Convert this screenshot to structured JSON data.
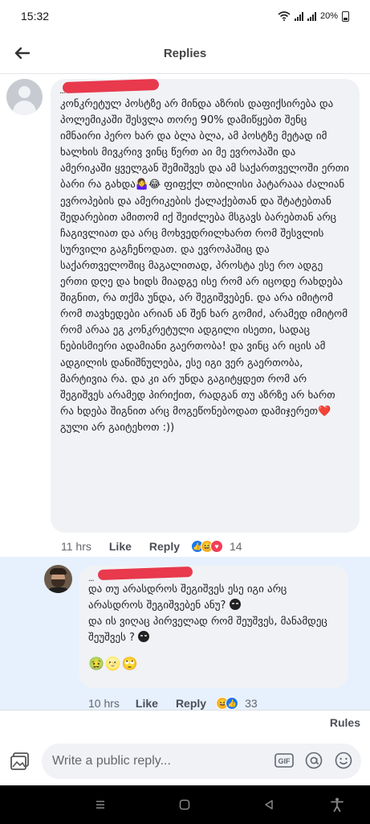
{
  "status_bar": {
    "time": "15:32",
    "battery": "20%"
  },
  "header": {
    "title": "Replies"
  },
  "comment": {
    "author_dots": "...",
    "text": "კონკრეტულ პოსტზე არ მინდა აზრის დაფიქსირება და პოლემიკაში შესვლა თორე 90% დამიწყებთ შენც იმნაირი პერო ხარ და ბლა ბლა, ამ პოსტზე მეტად იმ ხალხის მივკრივ ვინც წერთ აი მე ევროპაში და ამერიკაში ყველგან შემიშვეს და ამ საქართველოში ერთი ბარი რა გახდა🤷‍♀️😂 ფიფქლ თბილისი პატარააა ძალიან ევროპების და ამერიკების ქალაქებთან და შტატებთან შედარებით ამითომ იქ შეიძლება მსგავს ბარებთან არც ჩაგივლიათ და არც მოხვედრილხართ რომ შესვლის სურვილი გაგჩენოდათ. და ევროპაშიც და საქართველოშიც მაგალითად, პროსტა ესე რო ადგე ერთი დღე და ხიდს მიადგე ისე რომ არ იცოდე რახდება შიგნით, რა თქმა უნდა, არ შეგიშვებენ. და არა იმიტომ რომ თავხედები არიან ან შენ ხარ გომიძ, არამედ იმიტომ რომ არაა ეგ კონკრეტული ადგილი ისეთი, სადაც ნებისმიერი ადამიანი გაერთობა! და ვინც არ იცის ამ ადგილის დანიშნულება, ესე იგი ვერ გაერთობა, მარტივია რა. და კი არ უნდა გაგიტყდეთ რომ არ შეგიშვეს არამედ პირიქით, რადგან თუ აზრზე არ ხართ რა ხდება შიგნით არც მოგეწონებოდათ დამიჯერეთ❤️ გული არ გაიტეხოთ :))",
    "time": "11 hrs",
    "like_label": "Like",
    "reply_label": "Reply",
    "reaction_count": "14"
  },
  "reply": {
    "author_dots": "...",
    "line1": "და თუ არასდროს შეგიშვეს ესე იგი არც არასდროს შეგიშვებენ ანუ?",
    "line2": "და ის ვიღაც პირველად რომ შეუშვეს, მანამდეც შეუშვეს ?",
    "emojis": "🤢🌝🙄",
    "time": "10 hrs",
    "like_label": "Like",
    "reply_label": "Reply",
    "reaction_count": "33"
  },
  "rules_label": "Rules",
  "composer": {
    "placeholder": "Write a public reply..."
  },
  "icons": [
    "back-arrow-icon",
    "wifi-icon",
    "signal-icon",
    "battery-icon",
    "photo-icon",
    "gif-icon",
    "mention-icon",
    "emoji-icon",
    "recents-icon",
    "home-icon",
    "back-icon",
    "accessibility-icon"
  ],
  "colors": {
    "accent": "#1877f2",
    "bubble": "#f0f2f5",
    "highlight": "#e7f0fd",
    "redaction": "#e8394d"
  }
}
